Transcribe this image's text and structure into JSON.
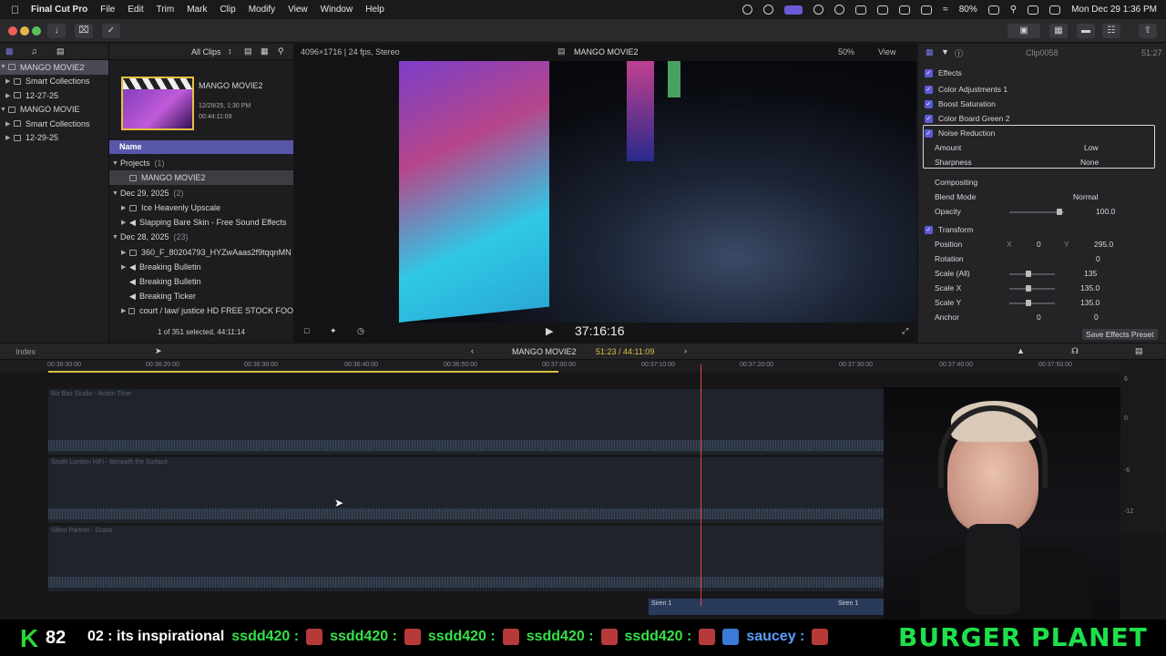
{
  "menubar": {
    "app": "Final Cut Pro",
    "items": [
      "File",
      "Edit",
      "Trim",
      "Mark",
      "Clip",
      "Modify",
      "View",
      "Window",
      "Help"
    ],
    "battery": "80%",
    "datetime": "Mon Dec 29  1:36 PM"
  },
  "library": {
    "rows": [
      {
        "label": "MANGO MOVIE2",
        "selected": true
      },
      {
        "label": "Smart Collections"
      },
      {
        "label": "12-27-25"
      },
      {
        "label": "MANGO MOVIE"
      },
      {
        "label": "Smart Collections"
      },
      {
        "label": "12-29-25"
      }
    ]
  },
  "browser": {
    "filter": "All Clips",
    "project_title": "MANGO MOVIE2",
    "project_date": "12/29/25, 1:30 PM",
    "project_duration": "00:44:11:09",
    "column_name": "Name",
    "rows": [
      {
        "label": "Projects",
        "count": "(1)"
      },
      {
        "label": "MANGO MOVIE2",
        "selected": true
      },
      {
        "label": "Dec 29, 2025",
        "count": "(2)"
      },
      {
        "label": "Ice Heavenly Upscale"
      },
      {
        "label": "Slapping Bare Skin - Free Sound Effects"
      },
      {
        "label": "Dec 28, 2025",
        "count": "(23)"
      },
      {
        "label": "360_F_80204793_HYZwAaas2f9tqqnMN"
      },
      {
        "label": "Breaking Bulletin"
      },
      {
        "label": "Breaking Bulletin"
      },
      {
        "label": "Breaking Ticker"
      },
      {
        "label": "court / law/ justice HD FREE STOCK FOO"
      }
    ],
    "status": "1 of 351 selected, 44:11:14"
  },
  "viewer": {
    "format": "4096×1716 | 24 fps, Stereo",
    "title": "MANGO MOVIE2",
    "zoom": "50%",
    "view": "View",
    "timecode": "37:16:16"
  },
  "inspector": {
    "clip": "Clip0058",
    "duration": "51:27",
    "effects_label": "Effects",
    "effects": [
      "Color Adjustments 1",
      "Boost Saturation",
      "Color Board Green 2",
      "Noise Reduction"
    ],
    "amount_label": "Amount",
    "amount_value": "Low",
    "sharpness_label": "Sharpness",
    "sharpness_value": "None",
    "compositing_label": "Compositing",
    "blend_label": "Blend Mode",
    "blend_value": "Normal",
    "opacity_label": "Opacity",
    "opacity_value": "100.0",
    "transform_label": "Transform",
    "position_label": "Position",
    "pos_x": "0",
    "pos_y": "295.0",
    "rotation_label": "Rotation",
    "rotation_value": "0",
    "scale_all_label": "Scale (All)",
    "scale_all_value": "135",
    "scale_x_label": "Scale X",
    "scale_x_value": "135.0",
    "scale_y_label": "Scale Y",
    "scale_y_value": "135.0",
    "anchor_label": "Anchor",
    "anchor_x": "0",
    "anchor_y": "0",
    "save_preset": "Save Effects Preset"
  },
  "timeline": {
    "index": "Index",
    "project": "MANGO MOVIE2",
    "position": "51:23 / 44:11:09",
    "ruler": [
      "00:36:30:00",
      "00:36:20:00",
      "00:36:30:00",
      "00:36:40:00",
      "00:36:50:00",
      "00:37:00:00",
      "00:37:10:00",
      "00:37:20:00",
      "00:37:30:00",
      "00:37:40:00",
      "00:37:50:00"
    ],
    "tracks": [
      "Biz Baz Studio - Action Time",
      "South London HiFi - Beneath the Surface",
      "Silent Partner - Grass"
    ],
    "sfx": [
      "Siren 1",
      "Siren 1"
    ],
    "meter_labels": [
      "6",
      "0",
      "-6",
      "-12"
    ]
  },
  "stream": {
    "k_letter": "K",
    "count": "82",
    "message": "02 : its inspirational",
    "user": "ssdd420 :",
    "user2": "saucey :",
    "banner": "BURGER PLANET"
  }
}
